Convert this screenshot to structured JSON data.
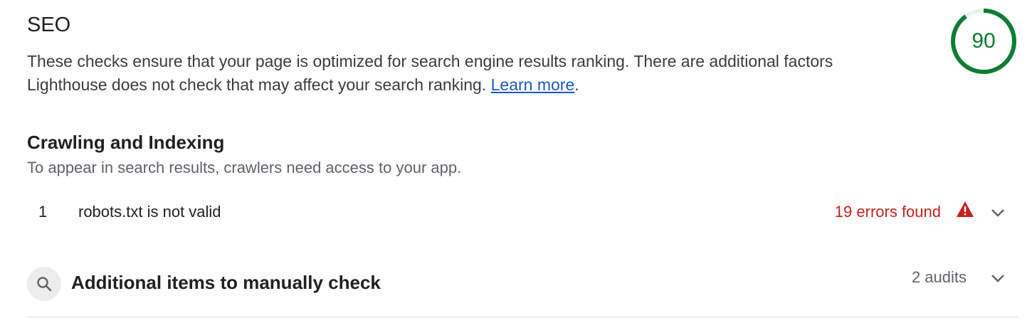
{
  "category": {
    "title": "SEO",
    "description": "These checks ensure that your page is optimized for search engine results ranking. There are additional factors Lighthouse does not check that may affect your search ranking.",
    "learn_more_label": "Learn more",
    "trailing_punct": ".",
    "score": "90",
    "score_fraction": 0.9,
    "score_color": "#0c7d33"
  },
  "group": {
    "title": "Crawling and Indexing",
    "description": "To appear in search results, crawlers need access to your app."
  },
  "audits": [
    {
      "index": "1",
      "title": "robots.txt is not valid",
      "status": "19 errors found",
      "status_color": "#c5221f",
      "icon": "warning-triangle-icon"
    }
  ],
  "manual": {
    "title": "Additional items to manually check",
    "count": "2 audits",
    "icon": "search-icon"
  }
}
